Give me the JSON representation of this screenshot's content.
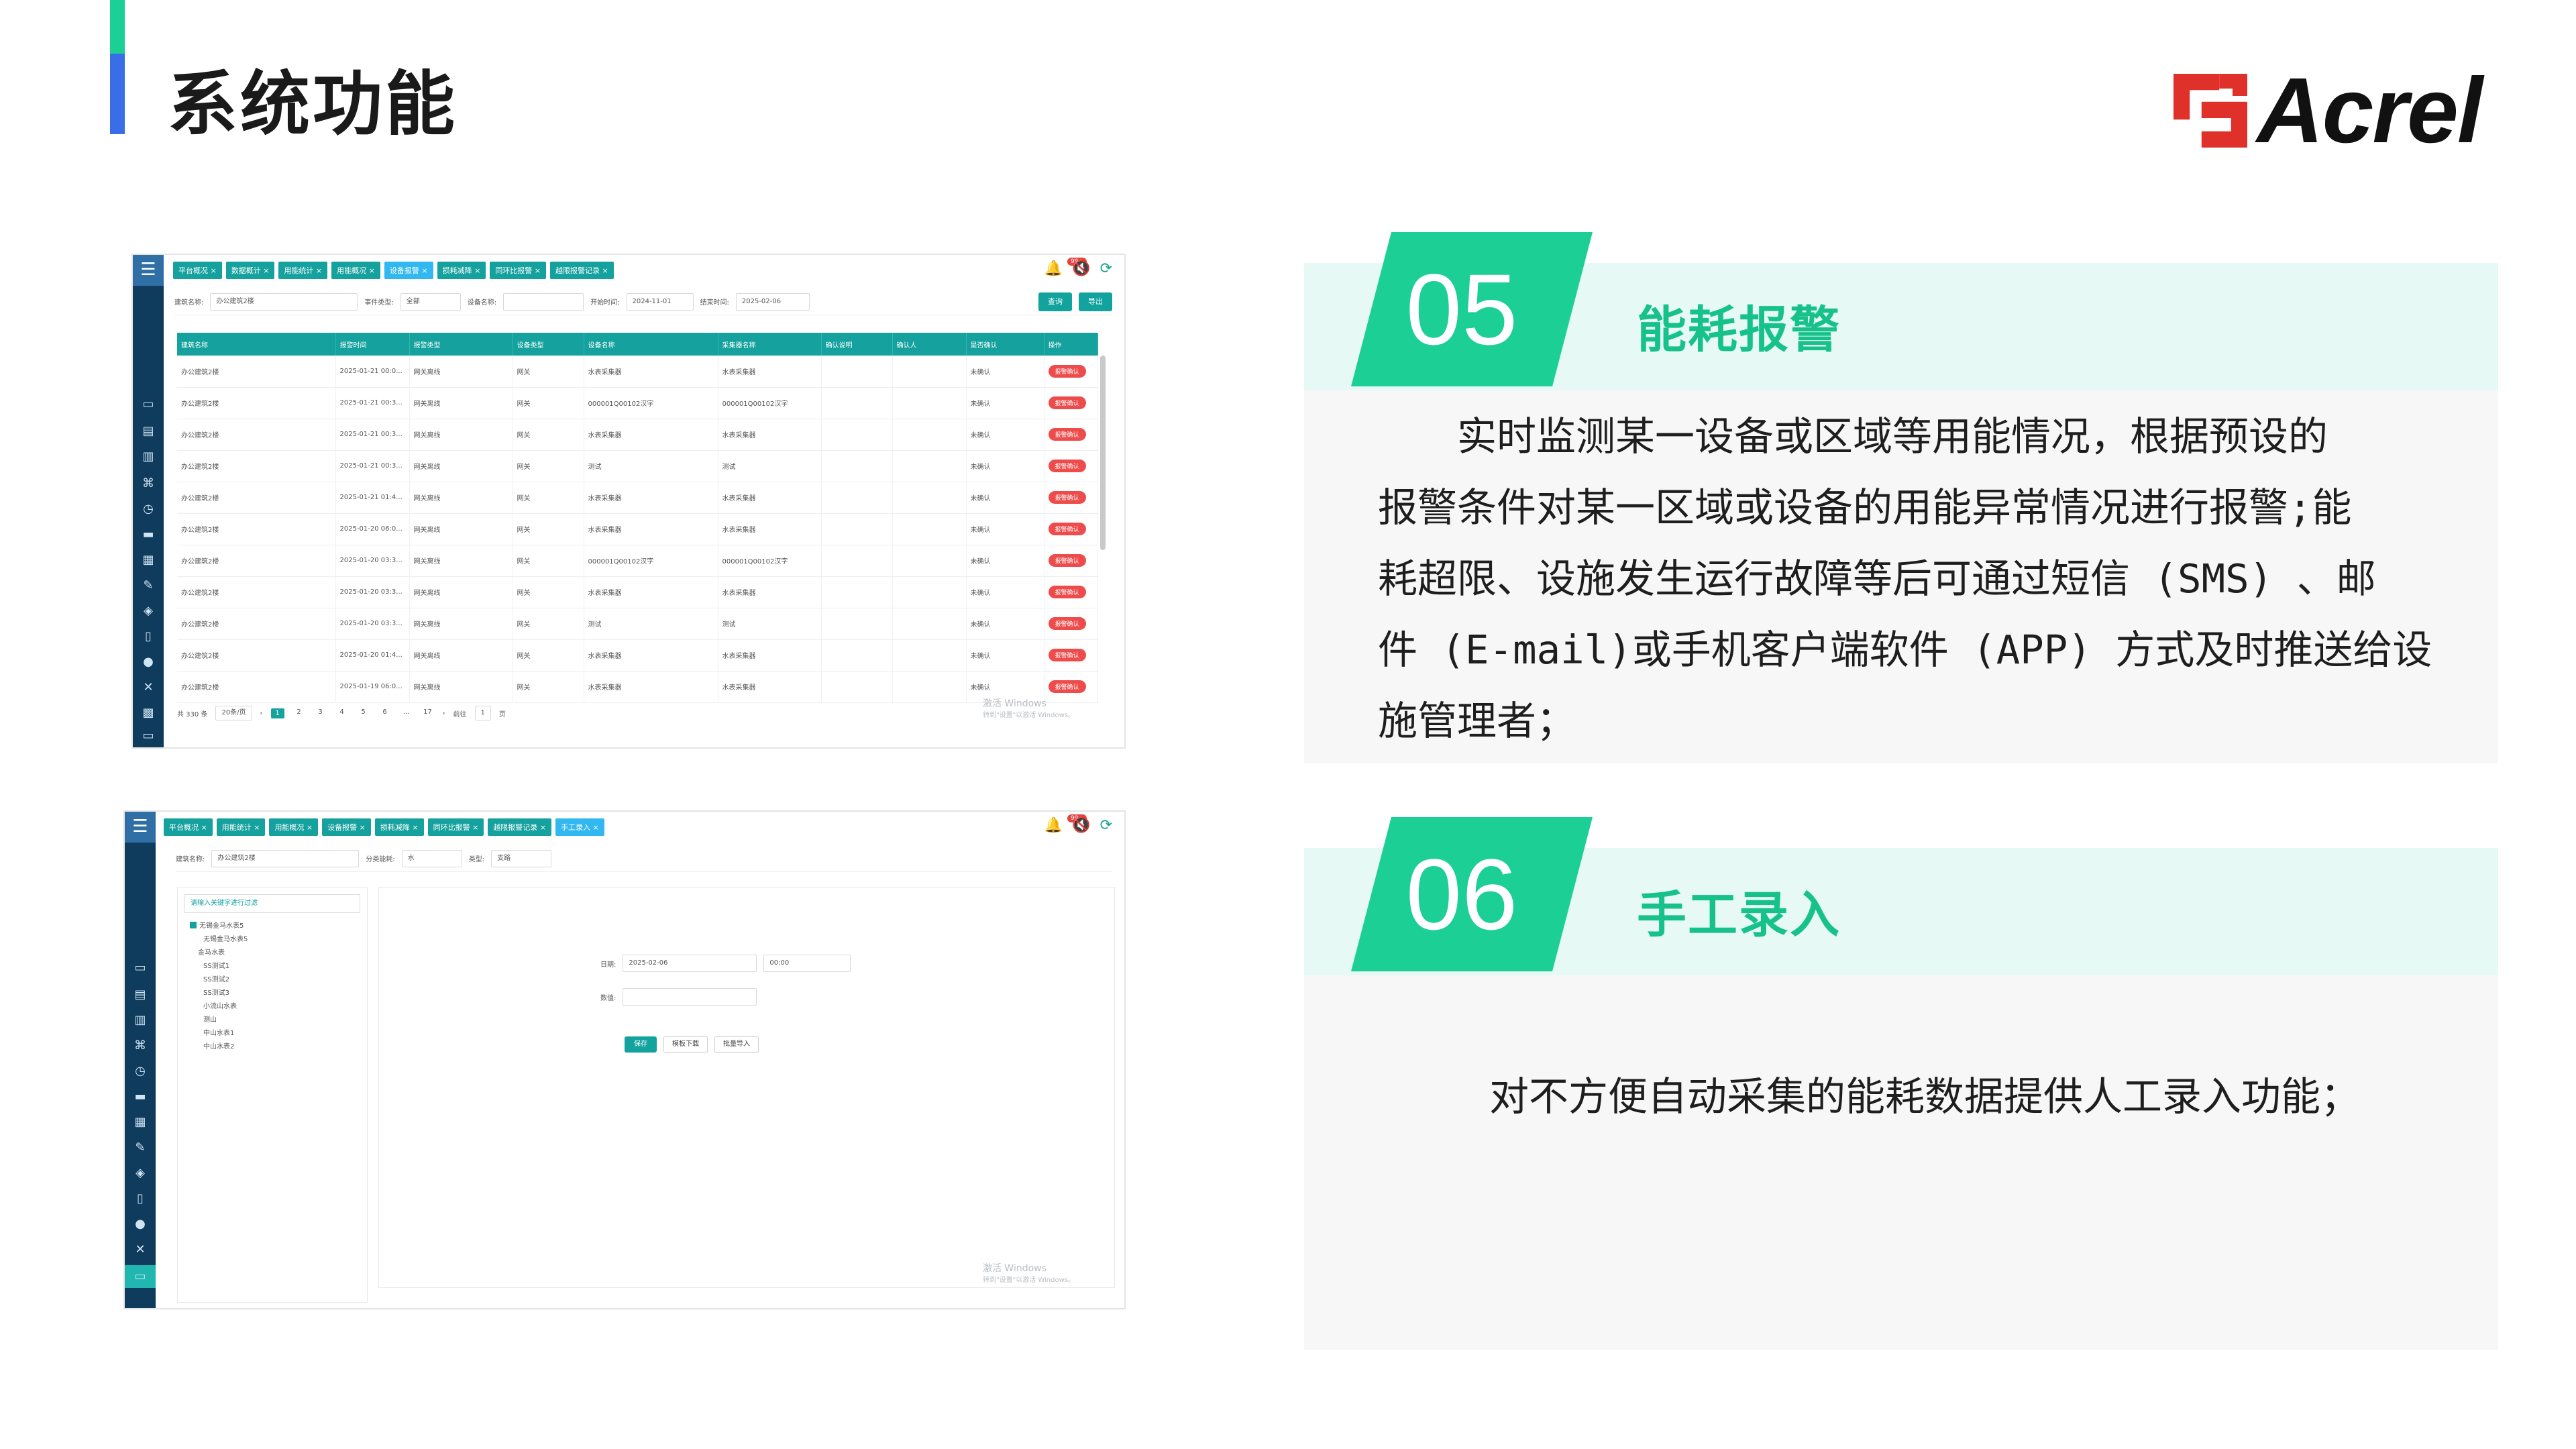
{
  "page": {
    "title": "系统功能",
    "logo_text": "Acrel"
  },
  "colors": {
    "accent_green": "#1ccf95",
    "accent_blue": "#3a6ee8",
    "teal": "#15a19e",
    "alarm_red": "#ee4c4c",
    "card_band": "#e6f9f4"
  },
  "screenshot1": {
    "tabs": [
      "平台概况 ×",
      "数据概计 ×",
      "用能统计 ×",
      "用能概况 ×",
      "设备报警 ×",
      "损耗减降 ×",
      "同环比报警 ×",
      "越限报警记录 ×"
    ],
    "active_tab": 4,
    "badge": "99+",
    "filters": {
      "building_label": "建筑名称:",
      "building_value": "办公建筑2楼",
      "event_label": "事件类型:",
      "event_value": "全部",
      "device_label": "设备名称:",
      "start_label": "开始时间:",
      "start_value": "2024-11-01",
      "end_label": "结束时间:",
      "end_value": "2025-02-06",
      "query_button": "查询",
      "export_button": "导出"
    },
    "columns": [
      "建筑名称",
      "报警时间",
      "报警类型",
      "设备类型",
      "设备名称",
      "采集器名称",
      "确认说明",
      "确认人",
      "是否确认",
      "操作"
    ],
    "rows": [
      [
        "办公建筑2楼",
        "2025-01-21 00:0...",
        "网关离线",
        "网关",
        "水表采集器",
        "水表采集器",
        "",
        "",
        "未确认",
        "报警确认"
      ],
      [
        "办公建筑2楼",
        "2025-01-21 00:3...",
        "网关离线",
        "网关",
        "000001Q00102汉字",
        "000001Q00102汉字",
        "",
        "",
        "未确认",
        "报警确认"
      ],
      [
        "办公建筑2楼",
        "2025-01-21 00:3...",
        "网关离线",
        "网关",
        "水表采集器",
        "水表采集器",
        "",
        "",
        "未确认",
        "报警确认"
      ],
      [
        "办公建筑2楼",
        "2025-01-21 00:3...",
        "网关离线",
        "网关",
        "测试",
        "测试",
        "",
        "",
        "未确认",
        "报警确认"
      ],
      [
        "办公建筑2楼",
        "2025-01-21 01:4...",
        "网关离线",
        "网关",
        "水表采集器",
        "水表采集器",
        "",
        "",
        "未确认",
        "报警确认"
      ],
      [
        "办公建筑2楼",
        "2025-01-20 06:0...",
        "网关离线",
        "网关",
        "水表采集器",
        "水表采集器",
        "",
        "",
        "未确认",
        "报警确认"
      ],
      [
        "办公建筑2楼",
        "2025-01-20 03:3...",
        "网关离线",
        "网关",
        "000001Q00102汉字",
        "000001Q00102汉字",
        "",
        "",
        "未确认",
        "报警确认"
      ],
      [
        "办公建筑2楼",
        "2025-01-20 03:3...",
        "网关离线",
        "网关",
        "水表采集器",
        "水表采集器",
        "",
        "",
        "未确认",
        "报警确认"
      ],
      [
        "办公建筑2楼",
        "2025-01-20 03:3...",
        "网关离线",
        "网关",
        "测试",
        "测试",
        "",
        "",
        "未确认",
        "报警确认"
      ],
      [
        "办公建筑2楼",
        "2025-01-20 01:4...",
        "网关离线",
        "网关",
        "水表采集器",
        "水表采集器",
        "",
        "",
        "未确认",
        "报警确认"
      ],
      [
        "办公建筑2楼",
        "2025-01-19 06:0...",
        "网关离线",
        "网关",
        "水表采集器",
        "水表采集器",
        "",
        "",
        "未确认",
        "报警确认"
      ]
    ],
    "pager": {
      "total": "共 330 条",
      "page_size": "20条/页",
      "pages": [
        "1",
        "2",
        "3",
        "4",
        "5",
        "6",
        "...",
        "17"
      ],
      "current": "1",
      "goto_label": "前往",
      "goto_value": "1",
      "goto_suffix": "页"
    },
    "watermark_title": "激活 Windows",
    "watermark_sub": "转到\"设置\"以激活 Windows。"
  },
  "screenshot2": {
    "tabs": [
      "平台概况 ×",
      "用能统计 ×",
      "用能概况 ×",
      "设备报警 ×",
      "损耗减降 ×",
      "同环比报警 ×",
      "越限报警记录 ×",
      "手工录入 ×"
    ],
    "active_tab": 7,
    "badge": "99+",
    "filters": {
      "building_label": "建筑名称:",
      "building_value": "办公建筑2楼",
      "category_label": "分类能耗:",
      "category_value": "水",
      "type_label": "类型:",
      "type_value": "支路"
    },
    "tree_search_placeholder": "请输入关键字进行过滤",
    "tree": [
      {
        "label": "无锡金马水表5",
        "level": 0,
        "checked": true
      },
      {
        "label": "无锡金马水表5",
        "level": 2,
        "checked": false
      },
      {
        "label": "金马水表",
        "level": 1,
        "checked": false
      },
      {
        "label": "SS测试1",
        "level": 2,
        "checked": false
      },
      {
        "label": "SS测试2",
        "level": 2,
        "checked": false
      },
      {
        "label": "SS测试3",
        "level": 2,
        "checked": false
      },
      {
        "label": "小流山水表",
        "level": 2,
        "checked": false
      },
      {
        "label": "测山",
        "level": 2,
        "checked": false
      },
      {
        "label": "中山水表1",
        "level": 2,
        "checked": false
      },
      {
        "label": "中山水表2",
        "level": 2,
        "checked": false
      }
    ],
    "form": {
      "date_label": "日期:",
      "date_value": "2025-02-06",
      "time_value": "00:00",
      "value_label": "数值:",
      "save_button": "保存",
      "template_button": "模板下载",
      "import_button": "批量导入"
    },
    "watermark_title": "激活 Windows",
    "watermark_sub": "转到\"设置\"以激活 Windows。"
  },
  "cards": [
    {
      "number": "05",
      "title": "能耗报警",
      "lines": [
        "　　实时监测某一设备或区域等用能情况，根据预设的",
        "报警条件对某一区域或设备的用能异常情况进行报警;能",
        "耗超限、设施发生运行故障等后可通过短信 (SMS) 、邮",
        "件 (E-mail)或手机客户端软件 (APP) 方式及时推送给设",
        "施管理者；"
      ]
    },
    {
      "number": "06",
      "title": "手工录入",
      "lines": [
        "对不方便自动采集的能耗数据提供人工录入功能；"
      ]
    }
  ]
}
